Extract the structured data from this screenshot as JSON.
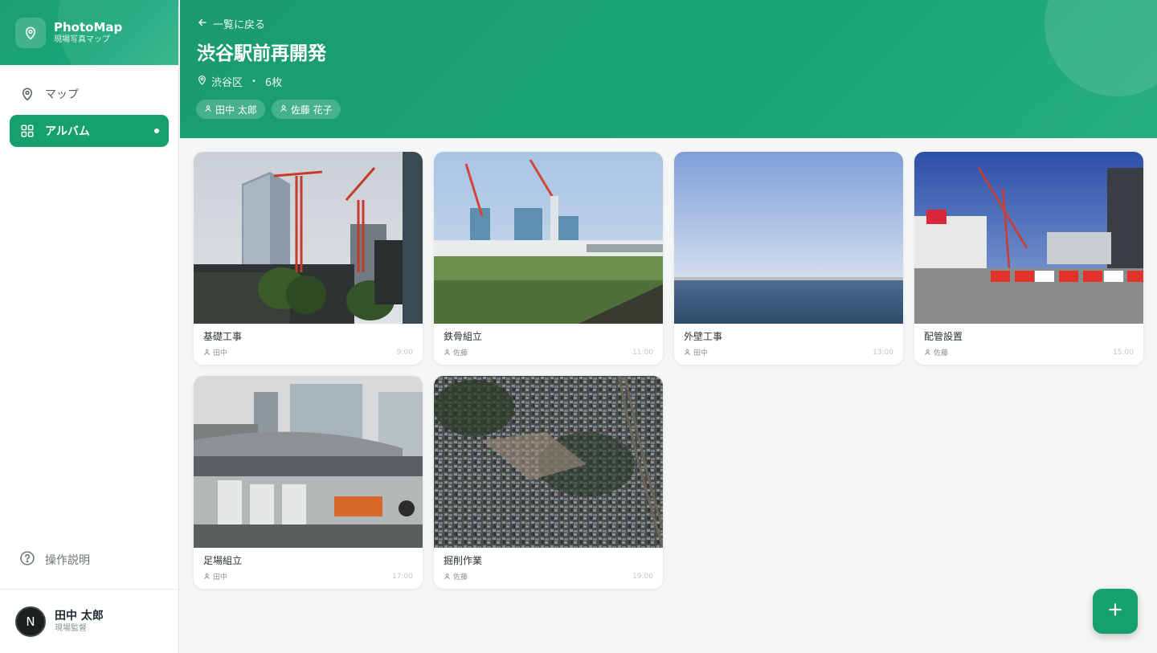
{
  "app": {
    "title": "PhotoMap",
    "subtitle": "現場写真マップ"
  },
  "sidebar": {
    "items": [
      {
        "label": "マップ",
        "icon": "map-pin-icon"
      },
      {
        "label": "アルバム",
        "icon": "grid-icon",
        "active": true
      }
    ],
    "help_label": "操作説明"
  },
  "user": {
    "initial": "N",
    "name": "田中 太郎",
    "role": "現場監督"
  },
  "header": {
    "back_label": "一覧に戻る",
    "title": "渋谷駅前再開発",
    "location": "渋谷区",
    "separator": "•",
    "count": "6枚",
    "members": [
      "田中 太郎",
      "佐藤 花子"
    ]
  },
  "photos": [
    {
      "title": "基礎工事",
      "author": "田中",
      "time": "9:00",
      "scene": "towers-cranes"
    },
    {
      "title": "鉄骨組立",
      "author": "佐藤",
      "time": "11:00",
      "scene": "port-cranes"
    },
    {
      "title": "外壁工事",
      "author": "田中",
      "time": "13:00",
      "scene": "sea"
    },
    {
      "title": "配管設置",
      "author": "佐藤",
      "time": "15:00",
      "scene": "street-barriers"
    },
    {
      "title": "足場組立",
      "author": "田中",
      "time": "17:00",
      "scene": "station-construction"
    },
    {
      "title": "掘削作業",
      "author": "佐藤",
      "time": "19:00",
      "scene": "aerial-city"
    }
  ],
  "colors": {
    "accent": "#16a06e",
    "header": "#1aa475"
  }
}
